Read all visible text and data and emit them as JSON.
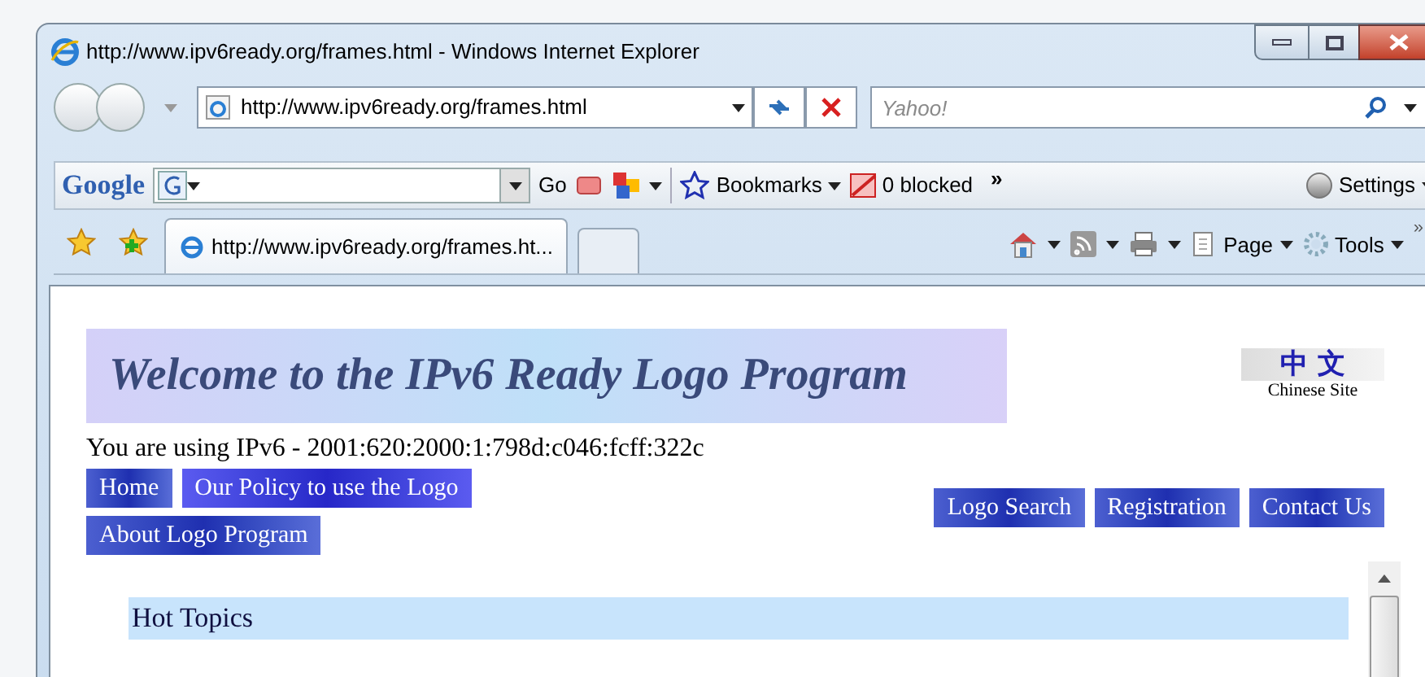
{
  "window": {
    "title": "http://www.ipv6ready.org/frames.html - Windows Internet Explorer"
  },
  "address_bar": {
    "value": "http://www.ipv6ready.org/frames.html"
  },
  "search_field": {
    "placeholder": "Yahoo!"
  },
  "google_toolbar": {
    "logo": "Google",
    "go": "Go",
    "bookmarks": "Bookmarks",
    "blocked": "0 blocked",
    "more": "»",
    "settings": "Settings"
  },
  "tabs": [
    {
      "label": "http://www.ipv6ready.org/frames.ht...",
      "selected": true
    }
  ],
  "command_bar": {
    "page": "Page",
    "tools": "Tools",
    "more": "»"
  },
  "page": {
    "banner": "Welcome to the IPv6 Ready Logo Program",
    "chinese_site": {
      "characters": "中 文",
      "caption": "Chinese Site"
    },
    "ip_text": "You are using IPv6 - 2001:620:2000:1:798d:c046:fcff:322c",
    "nav_left": [
      {
        "label": "Home",
        "highlighted": false
      },
      {
        "label": "Our Policy to use the Logo",
        "highlighted": true
      }
    ],
    "nav_right": [
      {
        "label": "Logo Search",
        "highlighted": false
      },
      {
        "label": "Registration",
        "highlighted": false
      },
      {
        "label": "Contact Us",
        "highlighted": false
      }
    ],
    "nav_second": [
      {
        "label": "About Logo Program",
        "highlighted": false
      }
    ],
    "hot_topics": "Hot Topics"
  }
}
